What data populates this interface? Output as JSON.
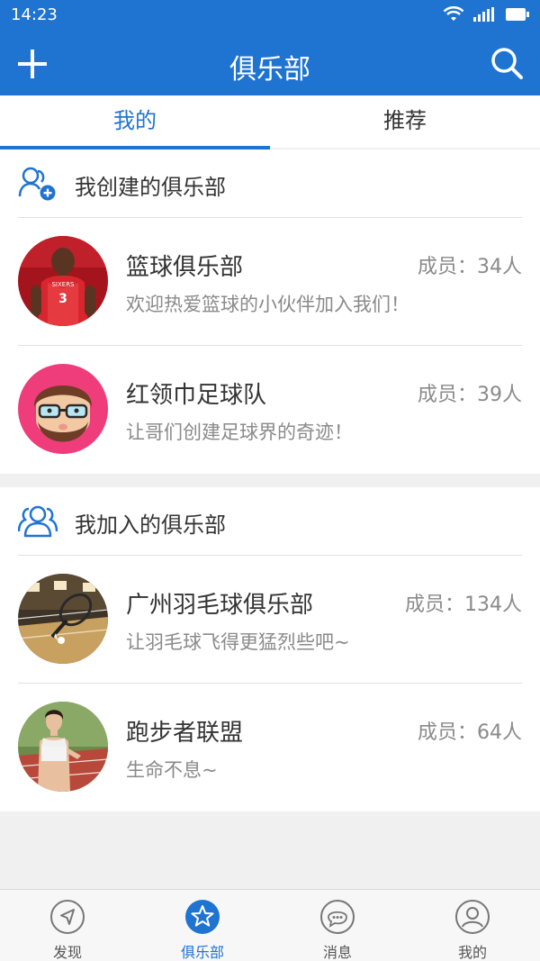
{
  "status": {
    "time": "14:23",
    "icons": [
      "wifi-icon",
      "signal-icon",
      "battery-icon"
    ]
  },
  "header": {
    "title": "俱乐部",
    "left_icon": "plus-icon",
    "right_icon": "search-icon"
  },
  "tabs": [
    {
      "label": "我的",
      "active": true
    },
    {
      "label": "推荐",
      "active": false
    }
  ],
  "created": {
    "title": "我创建的俱乐部",
    "icon": "add-user-icon",
    "clubs": [
      {
        "name": "篮球俱乐部",
        "count": "成员：34人",
        "desc": "欢迎热爱篮球的小伙伴加入我们！",
        "avatar": "basketball-player"
      },
      {
        "name": "红领巾足球队",
        "count": "成员：39人",
        "desc": "让哥们创建足球界的奇迹！",
        "avatar": "cartoon-face"
      }
    ]
  },
  "joined": {
    "title": "我加入的俱乐部",
    "icon": "group-icon",
    "clubs": [
      {
        "name": "广州羽毛球俱乐部",
        "count": "成员：134人",
        "desc": "让羽毛球飞得更猛烈些吧~",
        "avatar": "badminton-court"
      },
      {
        "name": "跑步者联盟",
        "count": "成员：64人",
        "desc": "生命不息~",
        "avatar": "runner-woman"
      }
    ]
  },
  "tabbar": [
    {
      "label": "发现",
      "icon": "compass-icon",
      "active": false
    },
    {
      "label": "俱乐部",
      "icon": "star-icon",
      "active": true
    },
    {
      "label": "消息",
      "icon": "chat-icon",
      "active": false
    },
    {
      "label": "我的",
      "icon": "user-icon",
      "active": false
    }
  ],
  "colors": {
    "primary": "#1f74d1",
    "background": "#f0f0f0",
    "text": "#333333",
    "muted": "#8a8a8a"
  }
}
